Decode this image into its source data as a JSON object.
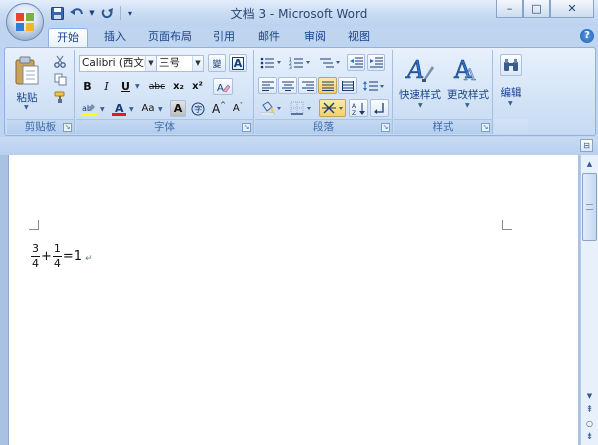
{
  "window": {
    "title": "文档 3 - Microsoft Word",
    "controls": {
      "minimize": "–",
      "maximize": "□",
      "close": "✕"
    }
  },
  "quick_access": {
    "save_icon": "save-icon",
    "undo_icon": "undo-icon",
    "redo_icon": "redo-icon",
    "customize_icon": "customize-icon"
  },
  "tabs": [
    {
      "label": "开始",
      "active": true
    },
    {
      "label": "插入"
    },
    {
      "label": "页面布局"
    },
    {
      "label": "引用"
    },
    {
      "label": "邮件"
    },
    {
      "label": "审阅"
    },
    {
      "label": "视图"
    }
  ],
  "help": "?",
  "ribbon": {
    "clipboard": {
      "label": "剪贴板",
      "paste_label": "粘贴"
    },
    "font": {
      "label": "字体",
      "font_name": "Calibri (西文i",
      "font_size": "三号",
      "bold": "B",
      "italic": "I",
      "underline": "U",
      "strikethrough": "abc",
      "subscript": "x₂",
      "superscript": "x²",
      "font_color_letter": "A",
      "change_case": "Aa",
      "grow": "A",
      "shrink": "A"
    },
    "paragraph": {
      "label": "段落"
    },
    "styles": {
      "label": "样式",
      "quick_styles": "快速样式",
      "change_styles": "更改样式"
    },
    "editing": {
      "label": "编辑"
    }
  },
  "document": {
    "equation": {
      "frac1_num": "3",
      "frac1_den": "4",
      "plus": "+",
      "frac2_num": "1",
      "frac2_den": "4",
      "equals": "=1",
      "paragraph_mark": "↵"
    }
  },
  "colors": {
    "accent": "#15428b",
    "ribbon_bg": "#d3e3f6",
    "highlight": "#f8cf6b",
    "font_red": "#e21b1b",
    "highlight_yellow": "#ffff00"
  }
}
